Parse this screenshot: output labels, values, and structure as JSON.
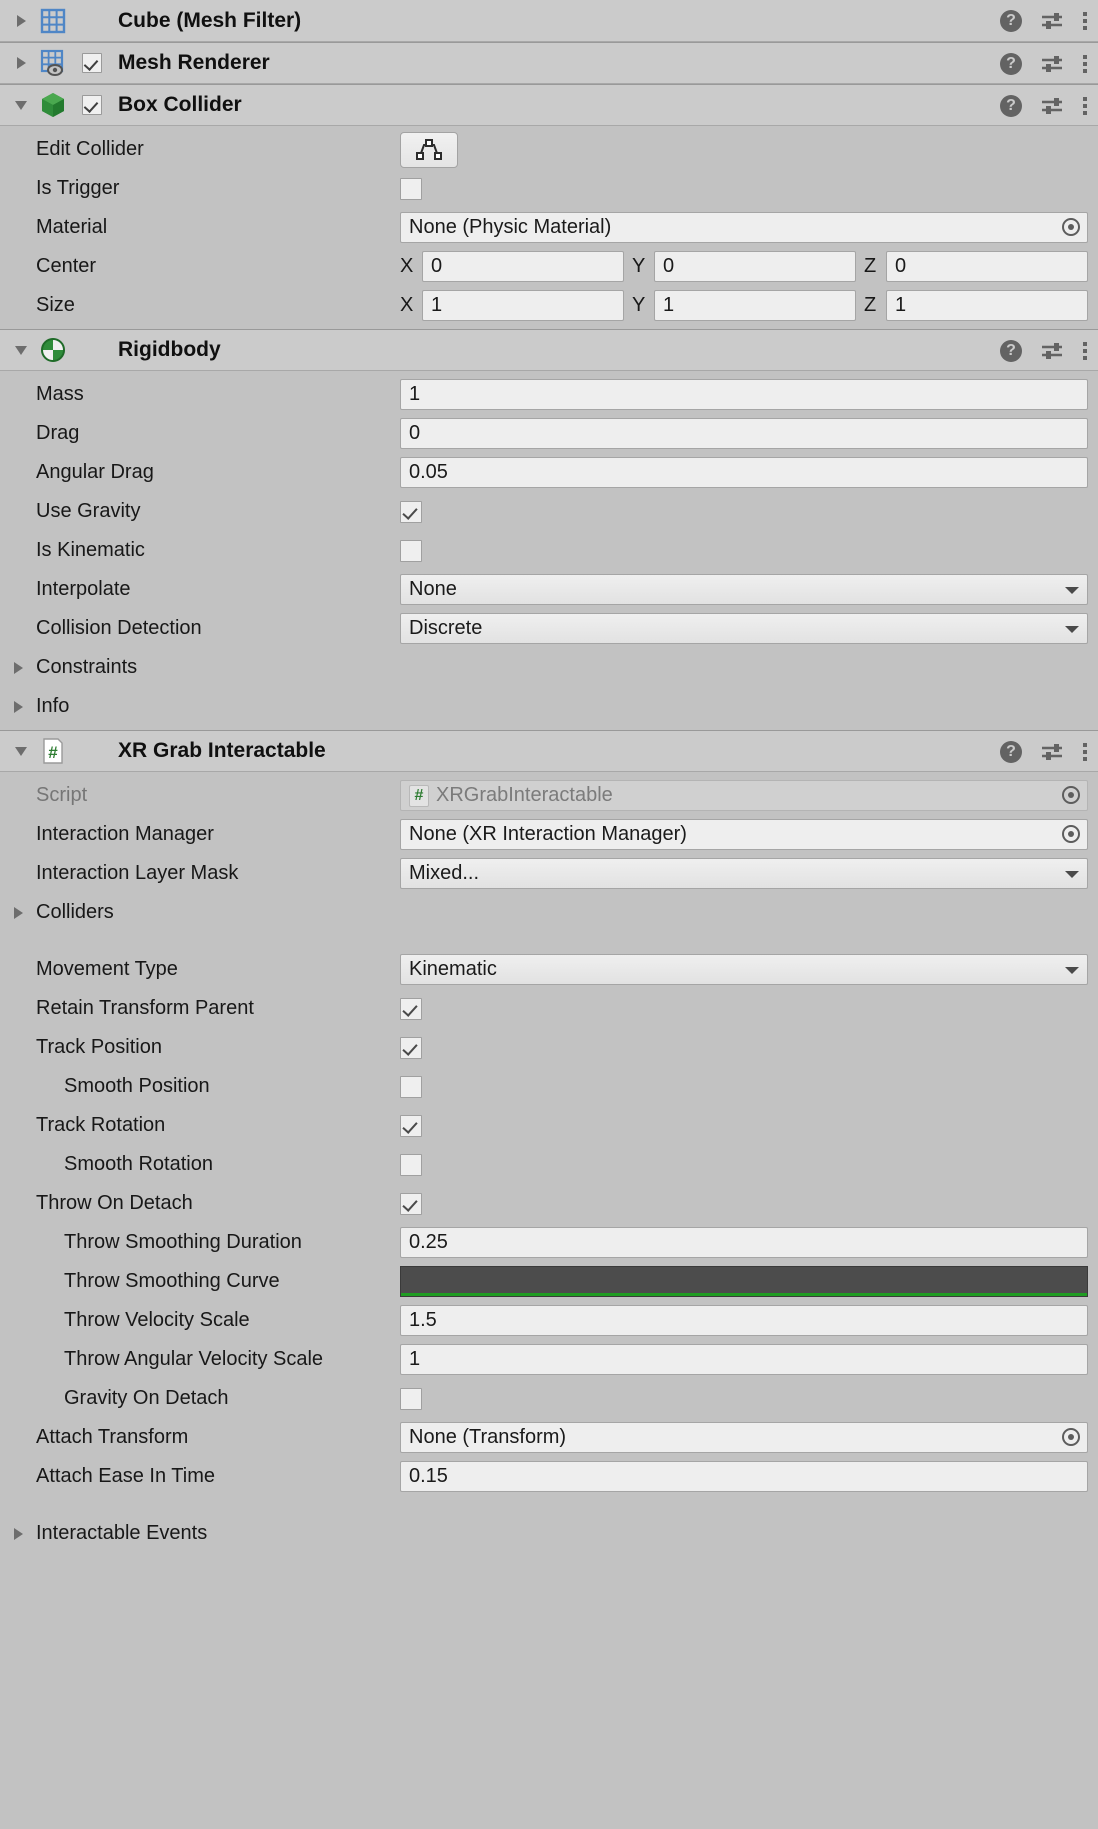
{
  "components": [
    {
      "id": "mesh-filter",
      "title": "Cube (Mesh Filter)",
      "icon": "mesh-filter-icon",
      "expanded": false,
      "has_checkbox": false,
      "checked": false
    },
    {
      "id": "mesh-renderer",
      "title": "Mesh Renderer",
      "icon": "mesh-renderer-icon",
      "expanded": false,
      "has_checkbox": true,
      "checked": true
    },
    {
      "id": "box-collider",
      "title": "Box Collider",
      "icon": "box-collider-icon",
      "expanded": true,
      "has_checkbox": true,
      "checked": true
    },
    {
      "id": "rigidbody",
      "title": "Rigidbody",
      "icon": "rigidbody-icon",
      "expanded": true,
      "has_checkbox": false,
      "checked": false
    },
    {
      "id": "xr-grab-interactable",
      "title": "XR Grab Interactable",
      "icon": "script-icon",
      "expanded": true,
      "has_checkbox": false,
      "checked": false
    }
  ],
  "header_icons": {
    "help": "?",
    "help_name": "help-icon",
    "preset_name": "preset-icon",
    "menu_name": "kebab-menu-icon"
  },
  "box_collider": {
    "edit_collider_label": "Edit Collider",
    "edit_collider_icon": "edit-collider-icon",
    "is_trigger_label": "Is Trigger",
    "is_trigger_value": false,
    "material_label": "Material",
    "material_value": "None (Physic Material)",
    "center_label": "Center",
    "center": {
      "x_axis": "X",
      "x": "0",
      "y_axis": "Y",
      "y": "0",
      "z_axis": "Z",
      "z": "0"
    },
    "size_label": "Size",
    "size": {
      "x_axis": "X",
      "x": "1",
      "y_axis": "Y",
      "y": "1",
      "z_axis": "Z",
      "z": "1"
    }
  },
  "rigidbody": {
    "mass_label": "Mass",
    "mass_value": "1",
    "drag_label": "Drag",
    "drag_value": "0",
    "angular_drag_label": "Angular Drag",
    "angular_drag_value": "0.05",
    "use_gravity_label": "Use Gravity",
    "use_gravity_value": true,
    "is_kinematic_label": "Is Kinematic",
    "is_kinematic_value": false,
    "interpolate_label": "Interpolate",
    "interpolate_value": "None",
    "collision_detection_label": "Collision Detection",
    "collision_detection_value": "Discrete",
    "constraints_label": "Constraints",
    "info_label": "Info"
  },
  "xr_grab": {
    "script_label": "Script",
    "script_value": "XRGrabInteractable",
    "script_chip": "#",
    "interaction_manager_label": "Interaction Manager",
    "interaction_manager_value": "None (XR Interaction Manager)",
    "interaction_layer_mask_label": "Interaction Layer Mask",
    "interaction_layer_mask_value": "Mixed...",
    "colliders_label": "Colliders",
    "movement_type_label": "Movement Type",
    "movement_type_value": "Kinematic",
    "retain_transform_parent_label": "Retain Transform Parent",
    "retain_transform_parent_value": true,
    "track_position_label": "Track Position",
    "track_position_value": true,
    "smooth_position_label": "Smooth Position",
    "smooth_position_value": false,
    "track_rotation_label": "Track Rotation",
    "track_rotation_value": true,
    "smooth_rotation_label": "Smooth Rotation",
    "smooth_rotation_value": false,
    "throw_on_detach_label": "Throw On Detach",
    "throw_on_detach_value": true,
    "throw_smoothing_duration_label": "Throw Smoothing Duration",
    "throw_smoothing_duration_value": "0.25",
    "throw_smoothing_curve_label": "Throw Smoothing Curve",
    "throw_smoothing_curve_color": "#1f9d22",
    "throw_velocity_scale_label": "Throw Velocity Scale",
    "throw_velocity_scale_value": "1.5",
    "throw_angular_velocity_scale_label": "Throw Angular Velocity Scale",
    "throw_angular_velocity_scale_value": "1",
    "gravity_on_detach_label": "Gravity On Detach",
    "gravity_on_detach_value": false,
    "attach_transform_label": "Attach Transform",
    "attach_transform_value": "None (Transform)",
    "attach_ease_in_time_label": "Attach Ease In Time",
    "attach_ease_in_time_value": "0.15",
    "interactable_events_label": "Interactable Events"
  }
}
